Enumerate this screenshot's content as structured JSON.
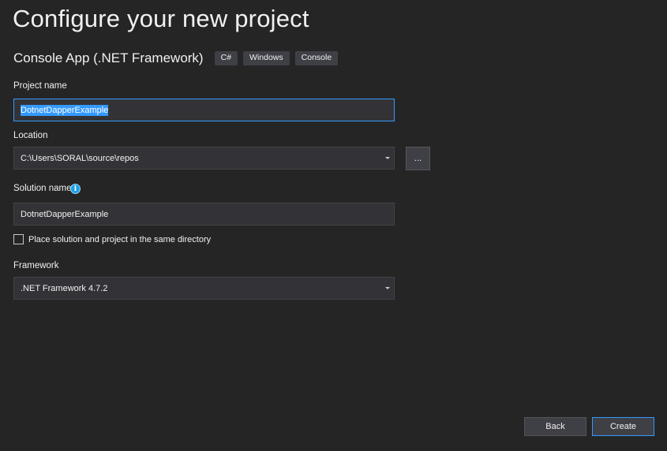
{
  "header": {
    "title": "Configure your new project"
  },
  "template": {
    "name": "Console App (.NET Framework)",
    "tags": [
      "C#",
      "Windows",
      "Console"
    ]
  },
  "project_name": {
    "label": "Project name",
    "value": "DotnetDapperExample"
  },
  "location": {
    "label": "Location",
    "value": "C:\\Users\\SORAL\\source\\repos",
    "browse_label": "..."
  },
  "solution_name": {
    "label": "Solution name",
    "info_icon": "info-icon",
    "value": "DotnetDapperExample"
  },
  "same_directory": {
    "label": "Place solution and project in the same directory",
    "checked": false
  },
  "framework": {
    "label": "Framework",
    "value": ".NET Framework 4.7.2"
  },
  "footer": {
    "back_label": "Back",
    "create_label": "Create"
  },
  "colors": {
    "background": "#252526",
    "field": "#333337",
    "accent": "#3399ff",
    "info": "#1ba1e2"
  }
}
